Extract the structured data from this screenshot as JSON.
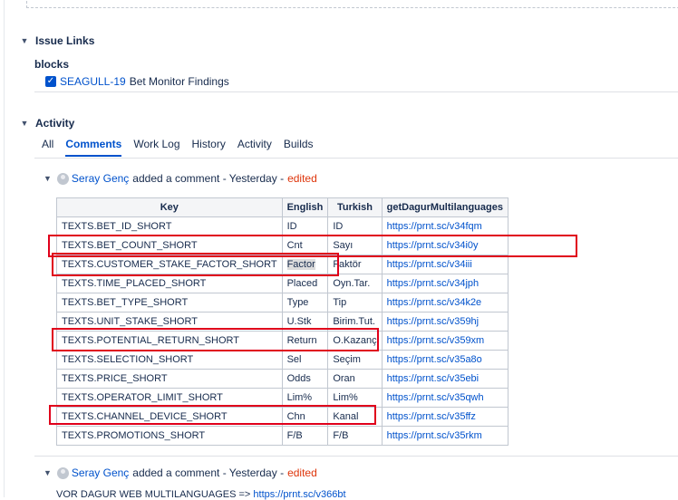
{
  "issue_links": {
    "title": "Issue Links",
    "relation": "blocks",
    "items": [
      {
        "key": "SEAGULL-19",
        "summary": "Bet Monitor Findings"
      }
    ]
  },
  "activity": {
    "title": "Activity",
    "tabs": [
      "All",
      "Comments",
      "Work Log",
      "History",
      "Activity",
      "Builds"
    ],
    "active_tab": "Comments"
  },
  "comments": [
    {
      "author": "Seray Genç",
      "action": "added a comment - Yesterday -",
      "edited": "edited"
    },
    {
      "author": "Seray Genç",
      "action": "added a comment - Yesterday -",
      "edited": "edited",
      "body_text": "VOR DAGUR WEB MULTILANGUAGES =>",
      "body_link": "https://prnt.sc/v366bt"
    }
  ],
  "table": {
    "headers": [
      "Key",
      "English",
      "Turkish",
      "getDagurMultilanguages"
    ],
    "rows": [
      [
        "TEXTS.BET_ID_SHORT",
        "ID",
        "ID",
        "https://prnt.sc/v34fqm"
      ],
      [
        "TEXTS.BET_COUNT_SHORT",
        "Cnt",
        "Sayı",
        "https://prnt.sc/v34i0y"
      ],
      [
        "TEXTS.CUSTOMER_STAKE_FACTOR_SHORT",
        "Factor",
        "Faktör",
        "https://prnt.sc/v34iii"
      ],
      [
        "TEXTS.TIME_PLACED_SHORT",
        "Placed",
        "Oyn.Tar.",
        "https://prnt.sc/v34jph"
      ],
      [
        "TEXTS.BET_TYPE_SHORT",
        "Type",
        "Tip",
        "https://prnt.sc/v34k2e"
      ],
      [
        "TEXTS.UNIT_STAKE_SHORT",
        "U.Stk",
        "Birim.Tut.",
        "https://prnt.sc/v359hj"
      ],
      [
        "TEXTS.POTENTIAL_RETURN_SHORT",
        "Return",
        "O.Kazanç",
        "https://prnt.sc/v359xm"
      ],
      [
        "TEXTS.SELECTION_SHORT",
        "Sel",
        "Seçim",
        "https://prnt.sc/v35a8o"
      ],
      [
        "TEXTS.PRICE_SHORT",
        "Odds",
        "Oran",
        "https://prnt.sc/v35ebi"
      ],
      [
        "TEXTS.OPERATOR_LIMIT_SHORT",
        "Lim%",
        "Lim%",
        "https://prnt.sc/v35qwh"
      ],
      [
        "TEXTS.CHANNEL_DEVICE_SHORT",
        "Chn",
        "Kanal",
        "https://prnt.sc/v35ffz"
      ],
      [
        "TEXTS.PROMOTIONS_SHORT",
        "F/B",
        "F/B",
        "https://prnt.sc/v35rkm"
      ]
    ]
  },
  "colors": {
    "link": "#0052cc",
    "edited": "#de350b",
    "highlight_box": "#e0001b"
  },
  "icons": {
    "collapse": "chevron-down-icon",
    "checkbox": "checkbox-checked-icon",
    "avatar": "user-avatar-icon"
  }
}
